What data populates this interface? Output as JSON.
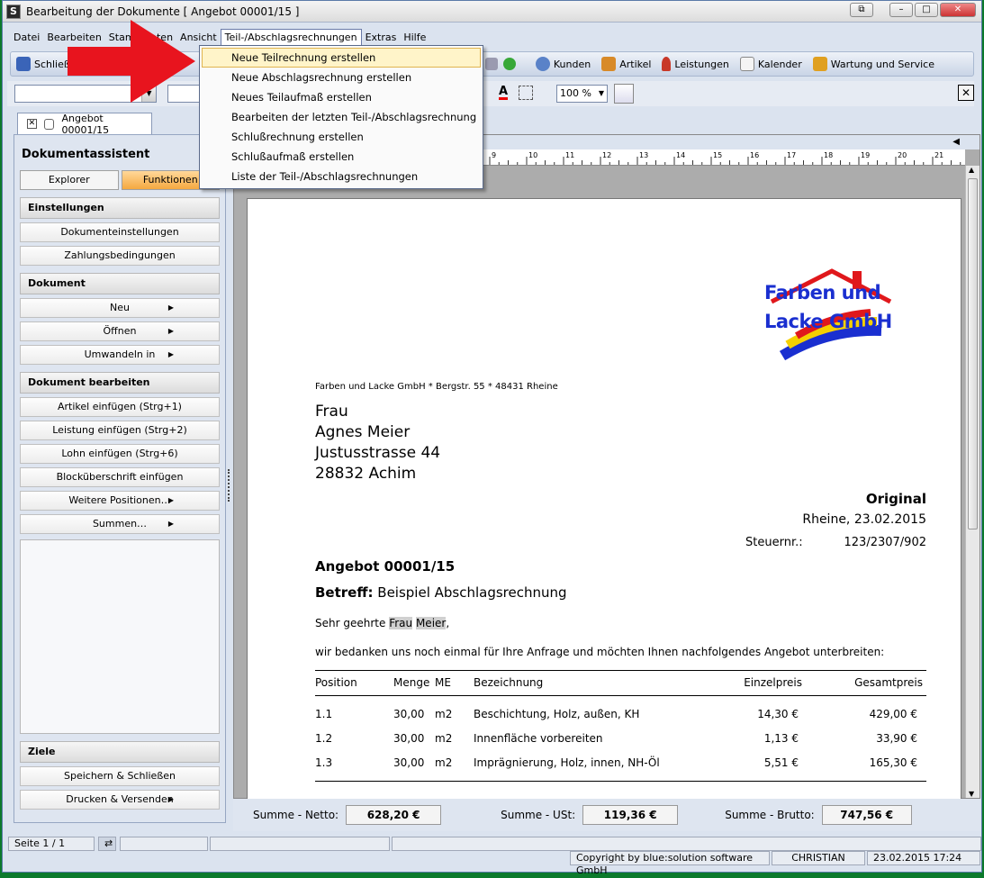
{
  "window": {
    "title": "Bearbeitung der Dokumente [ Angebot 00001/15 ]",
    "app_icon_letter": "S"
  },
  "menubar": [
    "Datei",
    "Bearbeiten",
    "Stammdaten",
    "Ansicht",
    "Teil-/Abschlagsrechnungen",
    "Extras",
    "Hilfe"
  ],
  "toolbar": {
    "close_label": "Schließen",
    "hidden_label": "nt",
    "right": [
      "Kunden",
      "Artikel",
      "Leistungen",
      "Kalender",
      "Wartung und Service"
    ]
  },
  "zoom": "100 %",
  "doc_tab": "Angebot 00001/15",
  "dropdown": [
    "Neue Teilrechnung erstellen",
    "Neue Abschlagsrechnung erstellen",
    "Neues Teilaufmaß erstellen",
    "Bearbeiten der letzten Teil-/Abschlagsrechnung",
    "Schlußrechnung erstellen",
    "Schlußaufmaß erstellen",
    "Liste der Teil-/Abschlagsrechnungen"
  ],
  "sidebar": {
    "title": "Dokumentassistent",
    "tabs": [
      "Explorer",
      "Funktionen"
    ],
    "sections": [
      {
        "head": "Einstellungen",
        "items": [
          {
            "label": "Dokumenteinstellungen",
            "sub": false
          },
          {
            "label": "Zahlungsbedingungen",
            "sub": false
          }
        ]
      },
      {
        "head": "Dokument",
        "items": [
          {
            "label": "Neu",
            "sub": true
          },
          {
            "label": "Öffnen",
            "sub": true
          },
          {
            "label": "Umwandeln  in",
            "sub": true
          }
        ]
      },
      {
        "head": "Dokument bearbeiten",
        "items": [
          {
            "label": "Artikel einfügen (Strg+1)",
            "sub": false
          },
          {
            "label": "Leistung einfügen (Strg+2)",
            "sub": false
          },
          {
            "label": "Lohn einfügen (Strg+6)",
            "sub": false
          },
          {
            "label": "Blocküberschrift einfügen",
            "sub": false
          },
          {
            "label": "Weitere Positionen…",
            "sub": true
          },
          {
            "label": "Summen…",
            "sub": true
          }
        ]
      }
    ],
    "ziele": {
      "head": "Ziele",
      "items": [
        {
          "label": "Speichern & Schließen",
          "sub": false
        },
        {
          "label": "Drucken & Versenden",
          "sub": true
        }
      ]
    }
  },
  "ruler_numbers": [
    "9",
    "10",
    "11",
    "12",
    "13",
    "14",
    "15",
    "16",
    "17",
    "18",
    "19",
    "20",
    "21"
  ],
  "document": {
    "logo_line1": "Farben und",
    "logo_line2": "Lacke GmbH",
    "sender": "Farben und Lacke GmbH * Bergstr. 55 * 48431 Rheine",
    "address": [
      "Frau",
      "Agnes Meier",
      "Justusstrasse 44",
      "28832 Achim"
    ],
    "original": "Original",
    "place_date": "Rheine,  23.02.2015",
    "tax_label": "Steuernr.:",
    "tax_value": "123/2307/902",
    "doc_title": "Angebot 00001/15",
    "subject_label": "Betreff:",
    "subject": "Beispiel Abschlagsrechnung",
    "greeting_a": "Sehr geehrte",
    "greeting_b": "Frau",
    "greeting_c": "Meier",
    "greeting_d": ",",
    "intro": "wir bedanken uns noch einmal für Ihre Anfrage und möchten Ihnen nachfolgendes Angebot unterbreiten:",
    "table_headers": [
      "Position",
      "Menge",
      "ME",
      "Bezeichnung",
      "Einzelpreis",
      "Gesamtpreis"
    ],
    "rows": [
      [
        "1.1",
        "30,00",
        "m2",
        "Beschichtung, Holz, außen, KH",
        "14,30 €",
        "429,00 €"
      ],
      [
        "1.2",
        "30,00",
        "m2",
        "Innenfläche vorbereiten",
        "1,13 €",
        "33,90 €"
      ],
      [
        "1.3",
        "30,00",
        "m2",
        "Imprägnierung, Holz, innen, NH-Öl",
        "5,51 €",
        "165,30 €"
      ]
    ]
  },
  "sums": {
    "netto_label": "Summe - Netto:",
    "netto": "628,20 €",
    "ust_label": "Summe - USt:",
    "ust": "119,36 €",
    "brutto_label": "Summe - Brutto:",
    "brutto": "747,56 €"
  },
  "status": {
    "page": "Seite 1 / 1",
    "copyright": "Copyright by blue:solution software GmbH",
    "user": "CHRISTIAN",
    "datetime": "23.02.2015 17:24"
  },
  "colors": {
    "arrow": "#e8141e",
    "logo_blue": "#1a2fd0",
    "logo_red": "#e0181c",
    "logo_yellow": "#f5d000"
  }
}
